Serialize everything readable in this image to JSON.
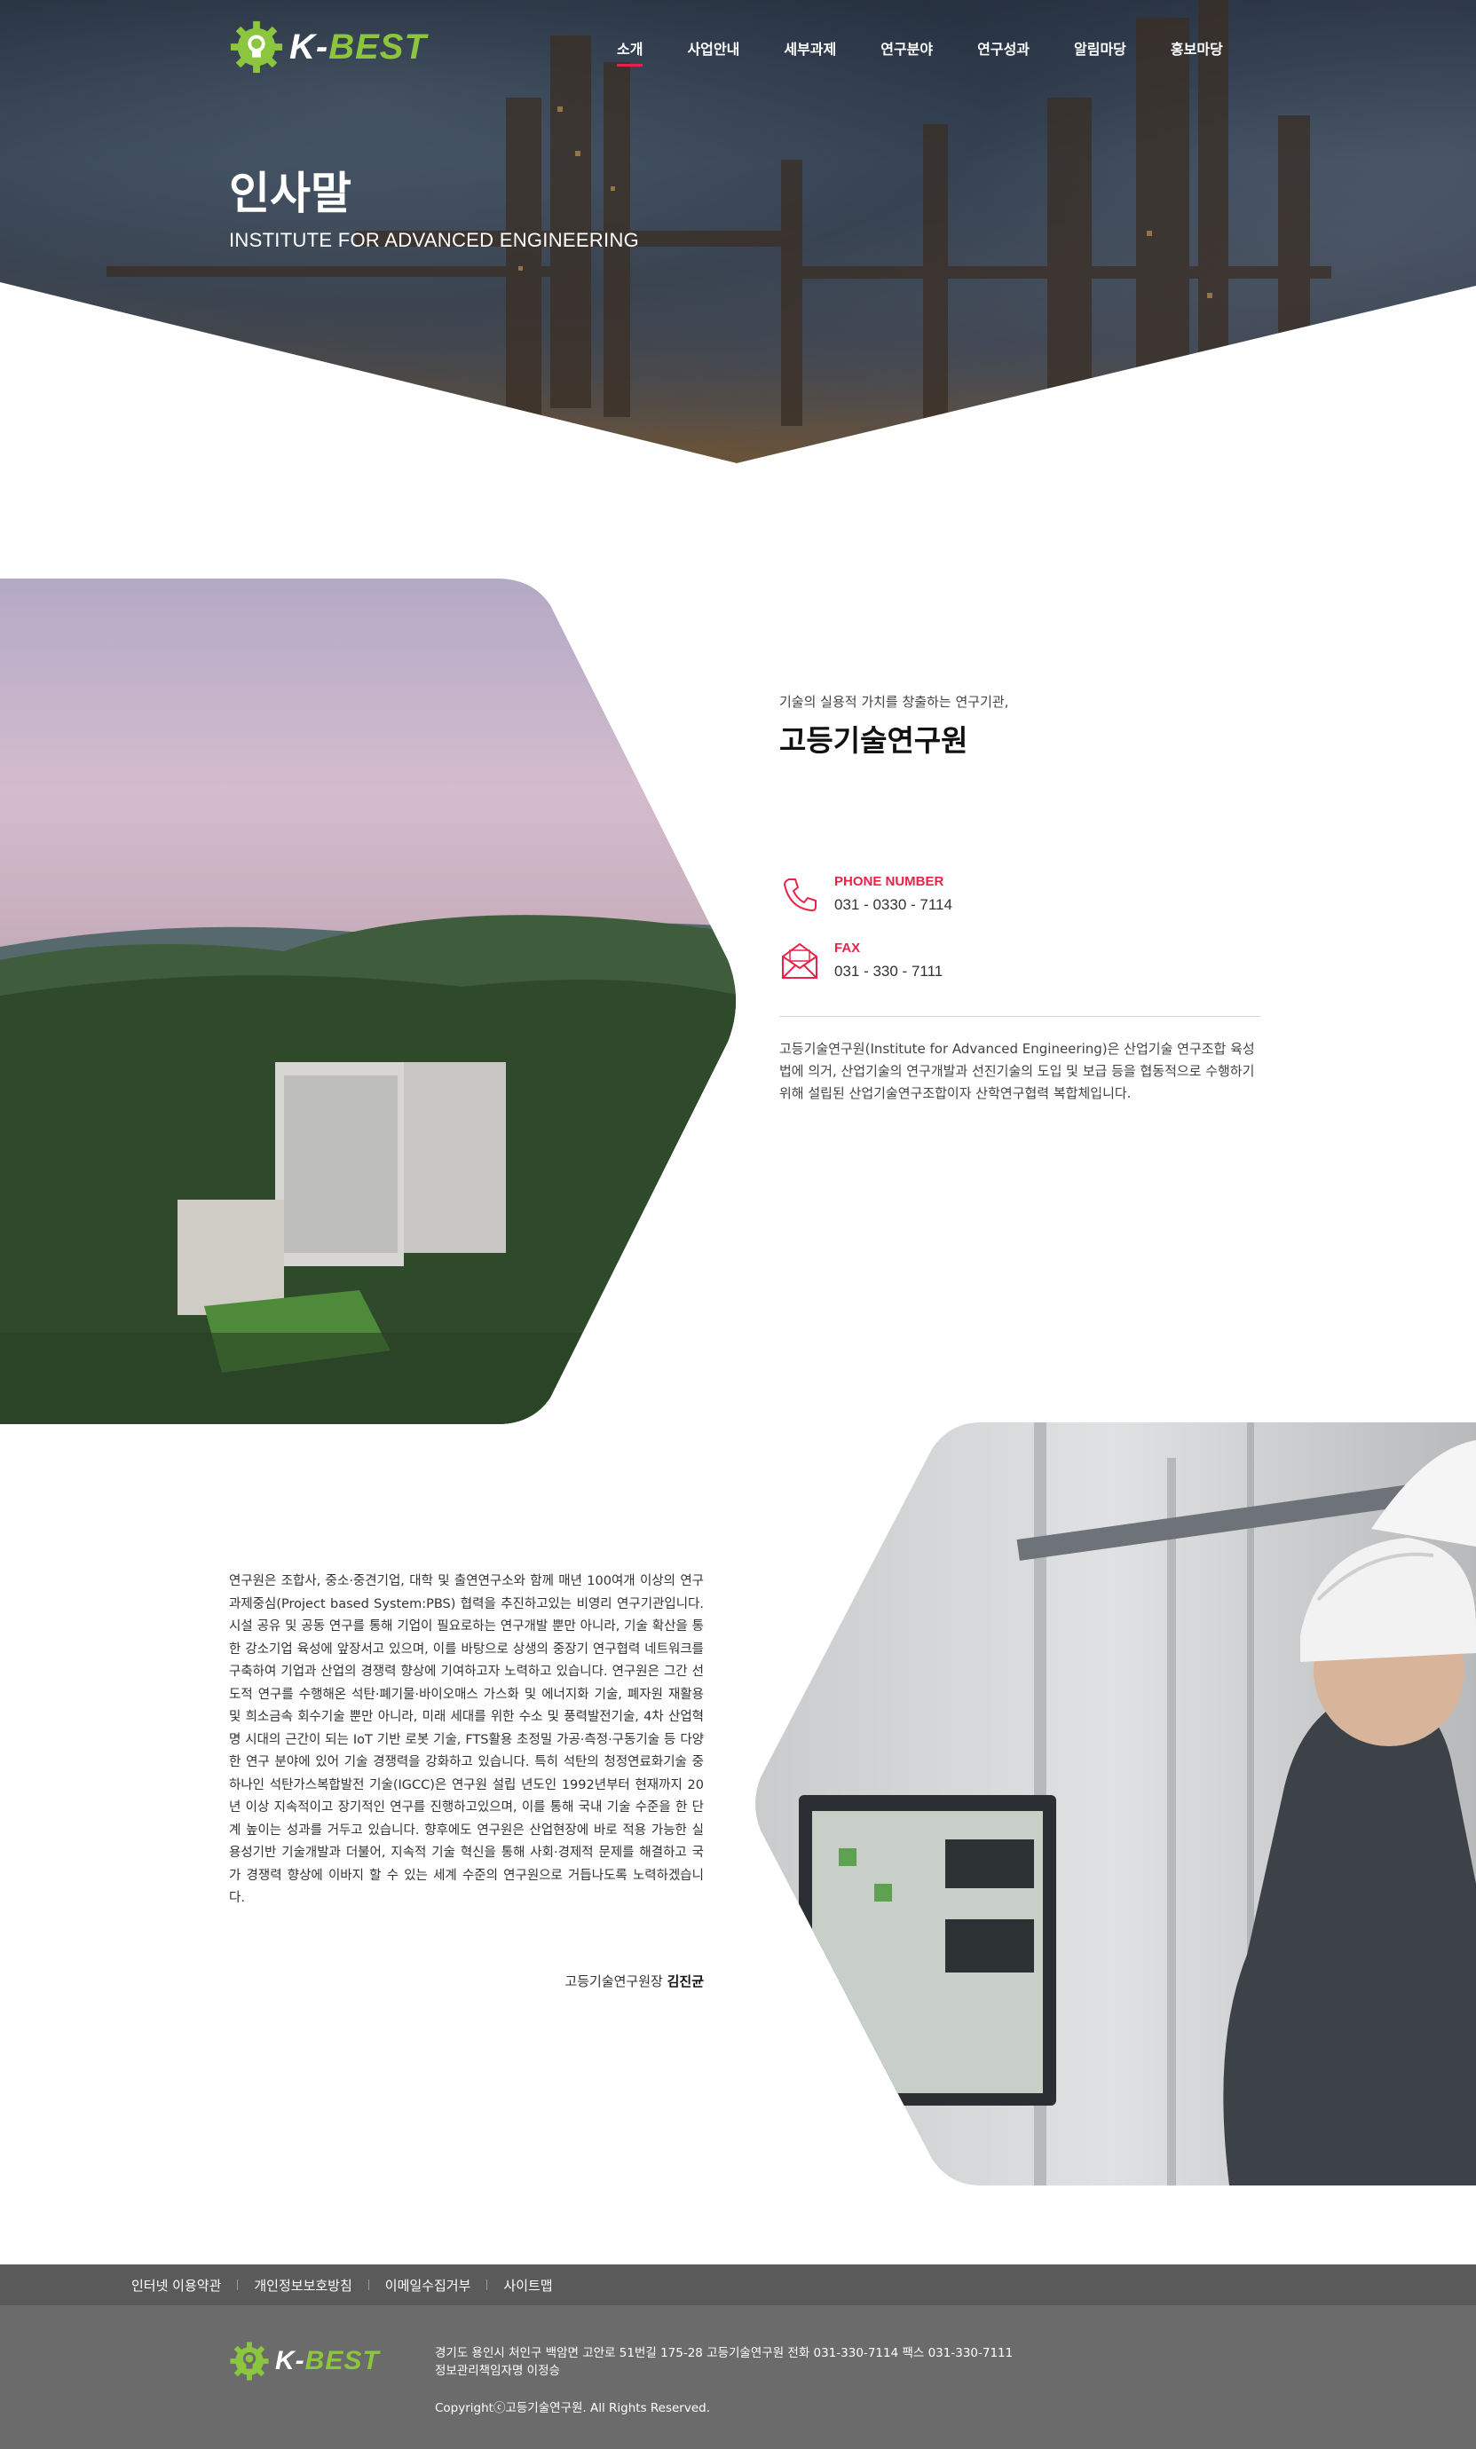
{
  "brand": {
    "logo_k": "K-",
    "logo_best": "BEST",
    "accent": "#8cc63f",
    "highlight": "#e8234a"
  },
  "nav": {
    "items": [
      {
        "label": "소개",
        "active": true
      },
      {
        "label": "사업안내"
      },
      {
        "label": "세부과제"
      },
      {
        "label": "연구분야"
      },
      {
        "label": "연구성과"
      },
      {
        "label": "알림마당"
      },
      {
        "label": "홍보마당"
      }
    ]
  },
  "hero": {
    "title": "인사말",
    "subtitle": "INSTITUTE FOR ADVANCED ENGINEERING"
  },
  "intro": {
    "tagline": "기술의 실용적 가치를 창출하는 연구기관,",
    "title": "고등기술연구원",
    "phone_label": "PHONE NUMBER",
    "phone_value": "031 - 0330 - 7114",
    "fax_label": "FAX",
    "fax_value": "031 - 330 - 7111",
    "description": "고등기술연구원(Institute for Advanced Engineering)은 산업기술 연구조합 육성법에 의거, 산업기술의 연구개발과 선진기술의 도입 및 보급 등을 협동적으로 수행하기 위해 설립된 산업기술연구조합이자 산학연구협력 복합체입니다."
  },
  "greeting": {
    "body": "연구원은 조합사, 중소·중견기업, 대학 및 출연연구소와 함께 매년 100여개 이상의 연구과제중심(Project based System:PBS) 협력을 추진하고있는 비영리 연구기관입니다. 시설 공유 및 공동 연구를 통해 기업이 필요로하는 연구개발 뿐만 아니라, 기술 확산을 통한 강소기업 육성에 앞장서고 있으며, 이를 바탕으로 상생의 중장기 연구협력 네트워크를 구축하여 기업과 산업의 경쟁력 향상에 기여하고자 노력하고 있습니다. 연구원은 그간 선도적 연구를 수행해온 석탄·폐기물·바이오매스 가스화 및 에너지화 기술, 폐자원 재활용 및 희소금속 회수기술 뿐만 아니라, 미래 세대를 위한 수소 및 풍력발전기술, 4차 산업혁명 시대의 근간이 되는 IoT 기반 로봇 기술, FTS활용 초정밀 가공·측정·구동기술 등 다양한 연구 분야에 있어 기술 경쟁력을 강화하고 있습니다. 특히 석탄의 청정연료화기술 중 하나인 석탄가스복합발전 기술(IGCC)은 연구원 설립 년도인 1992년부터 현재까지 20년 이상 지속적이고 장기적인 연구를 진행하고있으며, 이를 통해 국내 기술 수준을 한 단계 높이는 성과를 거두고 있습니다. 향후에도 연구원은 산업현장에 바로 적용 가능한 실용성기반 기술개발과 더불어, 지속적 기술 혁신을 통해 사회·경제적 문제를 해결하고 국가 경쟁력 향상에 이바지 할 수 있는 세계 수준의 연구원으로 거듭나도록 노력하겠습니다.",
    "sign_role": "고등기술연구원장 ",
    "sign_name": "김진균"
  },
  "footer": {
    "links": [
      "인터넷 이용약관",
      "개인정보보호방침",
      "이메일수집거부",
      "사이트맵"
    ],
    "address": "경기도 용인시 처인구 백암면 고안로 51번길 175-28 고등기술연구원  전화 031-330-7114  팩스 031-330-7111",
    "manager": "정보관리책임자명 이정승",
    "copyright": "Copyrightⓒ고등기술연구원.  All Rights Reserved."
  }
}
